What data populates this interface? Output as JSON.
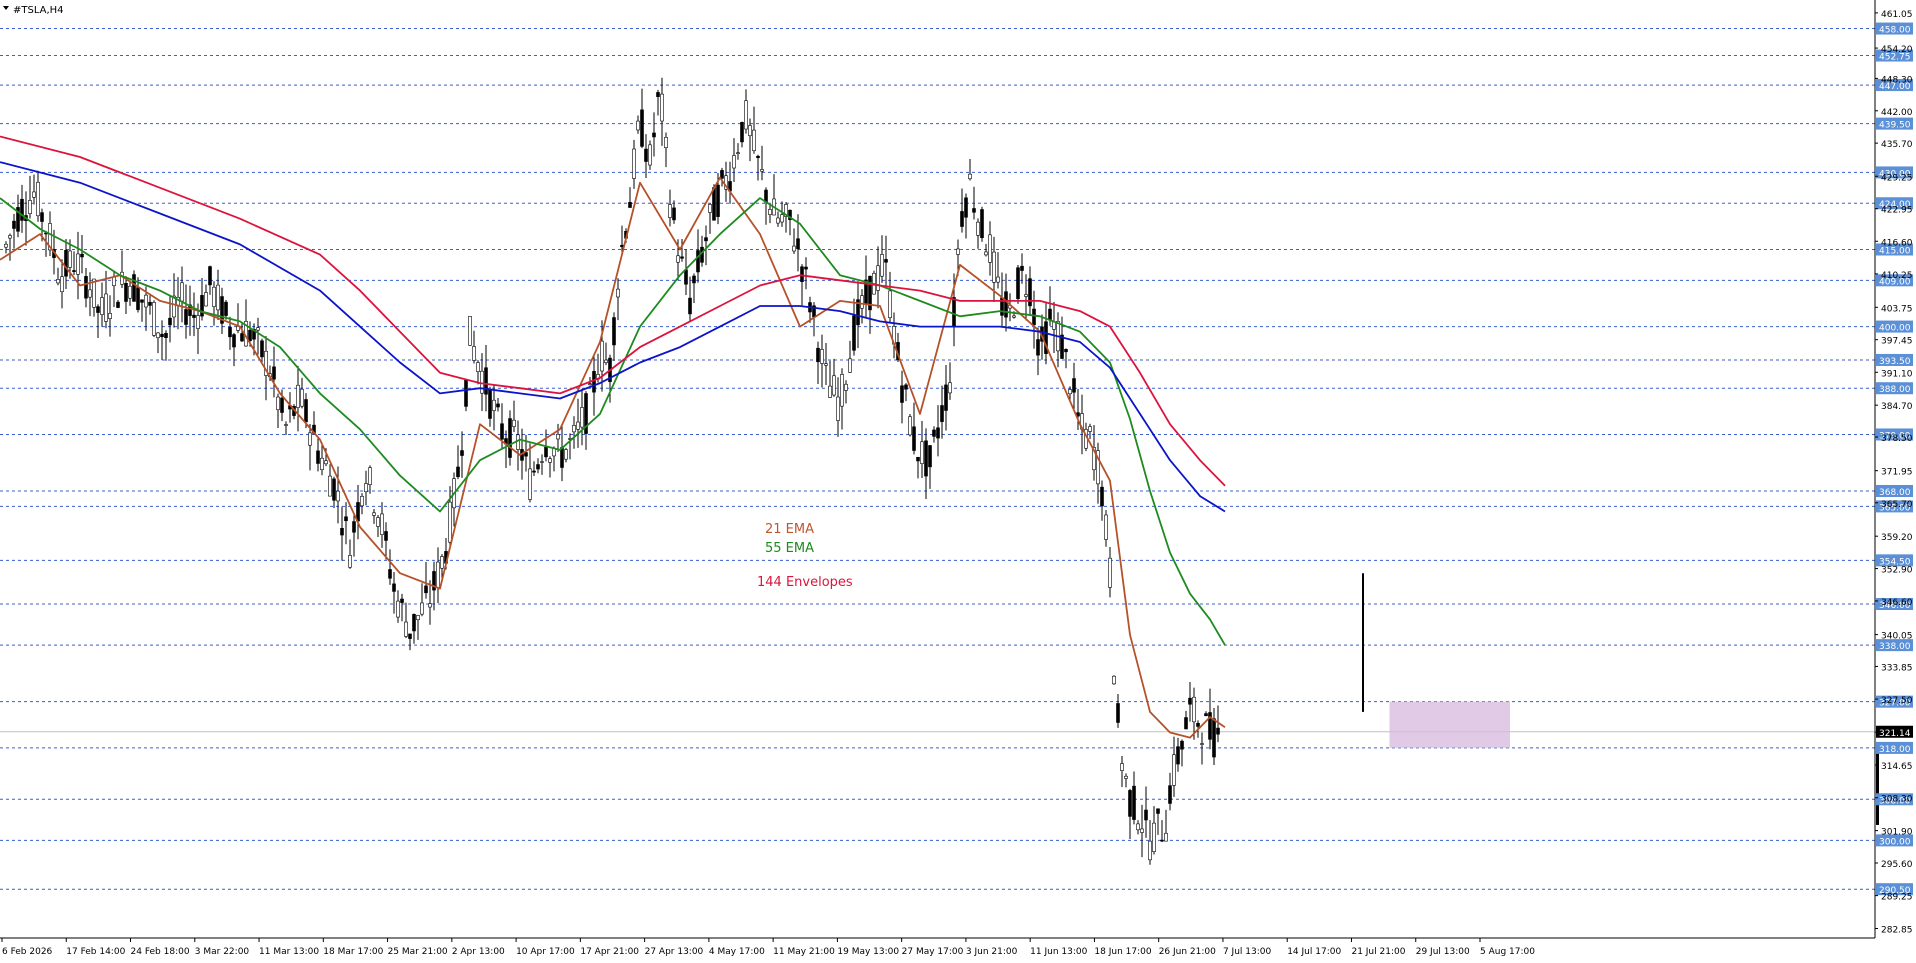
{
  "window": {
    "symbol_title": "#TSLA,H4"
  },
  "chart_data": {
    "type": "line",
    "title": "#TSLA,H4",
    "chart_style": "candlestick",
    "ylim": [
      281.0,
      462.0
    ],
    "y_ticks": [
      "461.05",
      "454.20",
      "448.30",
      "442.00",
      "435.70",
      "429.25",
      "422.95",
      "416.60",
      "410.25",
      "403.75",
      "397.45",
      "391.10",
      "384.70",
      "378.50",
      "371.95",
      "365.70",
      "359.20",
      "352.90",
      "346.60",
      "340.05",
      "333.85",
      "327.50",
      "321.05",
      "314.65",
      "308.30",
      "301.90",
      "295.60",
      "289.25",
      "282.85"
    ],
    "x_labels": [
      "6 Feb 2026",
      "17 Feb 14:00",
      "24 Feb 18:00",
      "3 Mar 22:00",
      "11 Mar 13:00",
      "18 Mar 17:00",
      "25 Mar 21:00",
      "2 Apr 13:00",
      "10 Apr 17:00",
      "17 Apr 21:00",
      "27 Apr 13:00",
      "4 May 17:00",
      "11 May 21:00",
      "19 May 13:00",
      "27 May 17:00",
      "3 Jun 21:00",
      "11 Jun 13:00",
      "18 Jun 17:00",
      "26 Jun 21:00",
      "7 Jul 13:00",
      "14 Jul 17:00",
      "21 Jul 21:00",
      "29 Jul 13:00",
      "5 Aug 17:00"
    ],
    "horizontal_levels": [
      458.0,
      452.75,
      447.0,
      439.5,
      430.0,
      424.0,
      415.0,
      409.0,
      400.0,
      393.5,
      388.0,
      379.0,
      368.0,
      365.0,
      354.5,
      346.0,
      338.0,
      327.0,
      318.0,
      308.0,
      300.0,
      290.5
    ],
    "level_labels": [
      "458.00",
      "452.75",
      "447.00",
      "439.50",
      "430.00",
      "424.00",
      "415.00",
      "409.00",
      "400.00",
      "393.50",
      "388.00",
      "379.00",
      "368.00",
      "365.00",
      "354.50",
      "346.00",
      "338.00",
      "327.00",
      "318.00",
      "308.00",
      "300.00",
      "290.50"
    ],
    "current_price": 321.14,
    "current_price_label": "321.14",
    "zone": {
      "from_x": "21 Jul 21:00",
      "to_x": "5 Aug 17:00",
      "y_low": 318.0,
      "y_high": 327.0,
      "color": "#d7b8dc"
    },
    "legend_text": {
      "ema21": "21 EMA",
      "ema55": "55 EMA",
      "env144": "144 Envelopes"
    },
    "series": [
      {
        "name": "21 EMA",
        "color": "#b5522a",
        "x": [
          0,
          40,
          80,
          120,
          160,
          200,
          240,
          280,
          320,
          360,
          400,
          440,
          480,
          520,
          560,
          600,
          640,
          680,
          720,
          760,
          800,
          840,
          880,
          920,
          960,
          1000,
          1040,
          1080,
          1110,
          1130,
          1150,
          1170,
          1190,
          1210,
          1225
        ],
        "values": [
          413,
          418,
          408,
          410,
          405,
          403,
          400,
          387,
          378,
          361,
          352,
          349,
          381,
          375,
          380,
          397,
          428,
          415,
          429,
          418,
          400,
          405,
          404,
          383,
          412,
          406,
          399,
          381,
          370,
          340,
          325,
          321,
          320,
          324,
          322
        ]
      },
      {
        "name": "55 EMA",
        "color": "#1e8b1e",
        "x": [
          0,
          40,
          80,
          120,
          160,
          200,
          240,
          280,
          320,
          360,
          400,
          440,
          480,
          520,
          560,
          600,
          640,
          680,
          720,
          760,
          800,
          840,
          880,
          920,
          960,
          1000,
          1040,
          1080,
          1110,
          1130,
          1150,
          1170,
          1190,
          1210,
          1225
        ],
        "values": [
          425,
          419,
          415,
          410,
          407,
          403,
          401,
          396,
          387,
          380,
          371,
          364,
          374,
          378,
          376,
          383,
          400,
          410,
          418,
          425,
          420,
          410,
          408,
          405,
          402,
          403,
          402,
          399,
          393,
          382,
          368,
          356,
          348,
          343,
          338
        ]
      },
      {
        "name": "144 EMA",
        "color": "#0b14c9",
        "x": [
          0,
          80,
          160,
          240,
          320,
          360,
          400,
          440,
          480,
          520,
          560,
          600,
          640,
          680,
          720,
          760,
          800,
          840,
          880,
          920,
          960,
          1000,
          1040,
          1080,
          1110,
          1140,
          1170,
          1200,
          1225
        ],
        "values": [
          432,
          428,
          422,
          416,
          407,
          400,
          393,
          387,
          388,
          387,
          386,
          389,
          393,
          396,
          400,
          404,
          404,
          403,
          401,
          400,
          400,
          400,
          399,
          397,
          392,
          383,
          374,
          367,
          364
        ]
      },
      {
        "name": "144 Envelopes",
        "color": "#dc143c",
        "x": [
          0,
          80,
          160,
          240,
          320,
          360,
          400,
          440,
          480,
          520,
          560,
          600,
          640,
          680,
          720,
          760,
          800,
          840,
          880,
          920,
          960,
          1000,
          1040,
          1080,
          1110,
          1140,
          1170,
          1200,
          1225
        ],
        "values": [
          437,
          433,
          427,
          421,
          414,
          407,
          399,
          391,
          389,
          388,
          387,
          390,
          396,
          400,
          404,
          408,
          410,
          409,
          408,
          407,
          405,
          405,
          405,
          403,
          400,
          391,
          381,
          374,
          369
        ]
      }
    ],
    "price_path": {
      "x": [
        5,
        20,
        35,
        50,
        60,
        75,
        90,
        100,
        115,
        130,
        150,
        165,
        180,
        195,
        210,
        230,
        250,
        270,
        285,
        300,
        320,
        335,
        350,
        365,
        380,
        395,
        410,
        430,
        445,
        460,
        470,
        480,
        500,
        520,
        530,
        545,
        560,
        575,
        590,
        600,
        610,
        620,
        630,
        640,
        650,
        660,
        670,
        680,
        690,
        700,
        715,
        730,
        745,
        760,
        775,
        790,
        800,
        810,
        825,
        840,
        855,
        870,
        885,
        900,
        915,
        930,
        940,
        950,
        960,
        970,
        980,
        990,
        1000,
        1010,
        1020,
        1030,
        1040,
        1050,
        1060,
        1070,
        1080,
        1090,
        1100,
        1110,
        1115,
        1120,
        1125,
        1130,
        1140,
        1150,
        1160,
        1165,
        1170,
        1180,
        1190,
        1200,
        1210,
        1215,
        1220
      ],
      "values": [
        415,
        423,
        426,
        417,
        410,
        413,
        408,
        402,
        407,
        409,
        403,
        398,
        405,
        402,
        408,
        400,
        399,
        392,
        380,
        386,
        375,
        369,
        357,
        372,
        363,
        348,
        341,
        347,
        356,
        374,
        398,
        392,
        380,
        377,
        370,
        378,
        375,
        378,
        385,
        395,
        392,
        413,
        425,
        440,
        432,
        446,
        425,
        413,
        405,
        413,
        424,
        430,
        441,
        430,
        421,
        420,
        414,
        405,
        390,
        385,
        400,
        407,
        412,
        391,
        377,
        373,
        382,
        390,
        421,
        428,
        420,
        415,
        405,
        402,
        410,
        408,
        395,
        401,
        398,
        390,
        380,
        378,
        372,
        352,
        330,
        318,
        312,
        308,
        305,
        300,
        303,
        302,
        310,
        318,
        325,
        323,
        321,
        320,
        321
      ]
    }
  }
}
